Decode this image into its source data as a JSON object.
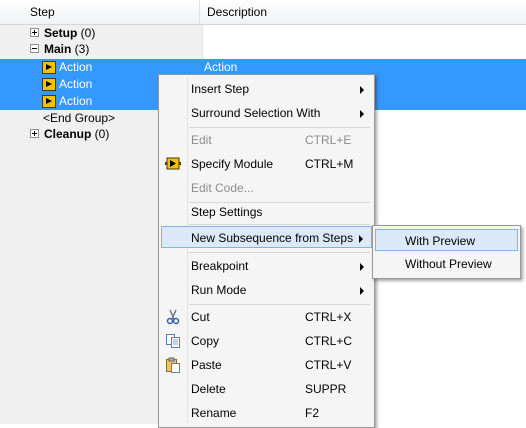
{
  "header": {
    "step_label": "Step",
    "description_label": "Description"
  },
  "rows": {
    "setup": {
      "label": "Setup",
      "count": " (0)"
    },
    "main": {
      "label": "Main",
      "count": " (3)"
    },
    "action1": {
      "step": "Action",
      "description": "Action"
    },
    "action2": {
      "step": "Action",
      "description": ""
    },
    "action3": {
      "step": "Action",
      "description": ""
    },
    "end_group": {
      "step": "<End Group>"
    },
    "cleanup": {
      "label": "Cleanup",
      "count": " (0)"
    }
  },
  "menu": {
    "insert_step": "Insert Step",
    "surround_selection": "Surround Selection With",
    "edit": "Edit",
    "edit_shortcut": "CTRL+E",
    "specify_module": "Specify Module",
    "specify_module_shortcut": "CTRL+M",
    "edit_code": "Edit Code...",
    "step_settings": "Step Settings",
    "new_subsequence": "New Subsequence from Steps",
    "breakpoint": "Breakpoint",
    "run_mode": "Run Mode",
    "cut": "Cut",
    "cut_shortcut": "CTRL+X",
    "copy": "Copy",
    "copy_shortcut": "CTRL+C",
    "paste": "Paste",
    "paste_shortcut": "CTRL+V",
    "delete": "Delete",
    "delete_shortcut": "SUPPR",
    "rename": "Rename",
    "rename_shortcut": "F2"
  },
  "submenu": {
    "with_preview": "With Preview",
    "without_preview": "Without Preview"
  },
  "icons": {
    "step": "action-step-icon",
    "cut": "scissors-icon",
    "copy": "copy-icon",
    "paste": "paste-icon",
    "specify_module": "module-icon"
  },
  "colors": {
    "selection": "#3399ff",
    "menu_highlight": "#dbe9f9",
    "menu_highlight_border": "#7eb4ea"
  }
}
